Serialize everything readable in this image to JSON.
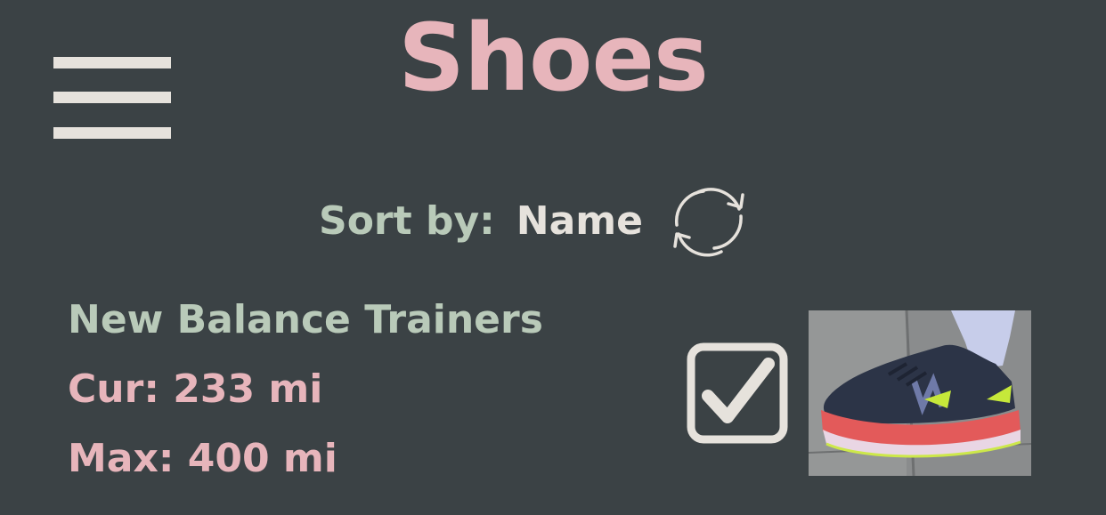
{
  "header": {
    "title": "Shoes",
    "menu_icon": "hamburger-menu-icon"
  },
  "sort": {
    "label": "Sort by:",
    "value": "Name",
    "toggle_icon": "refresh-cycle-icon"
  },
  "shoes": [
    {
      "name": "New Balance Trainers",
      "current": "Cur: 233 mi",
      "max": "Max: 400 mi",
      "checked": true,
      "photo_icon": "running-shoe-photo"
    }
  ],
  "colors": {
    "background": "#3b4245",
    "title": "#e7b5bb",
    "accent_green": "#b9cab9",
    "light": "#e6e2dc",
    "pink": "#e7b5bb"
  }
}
